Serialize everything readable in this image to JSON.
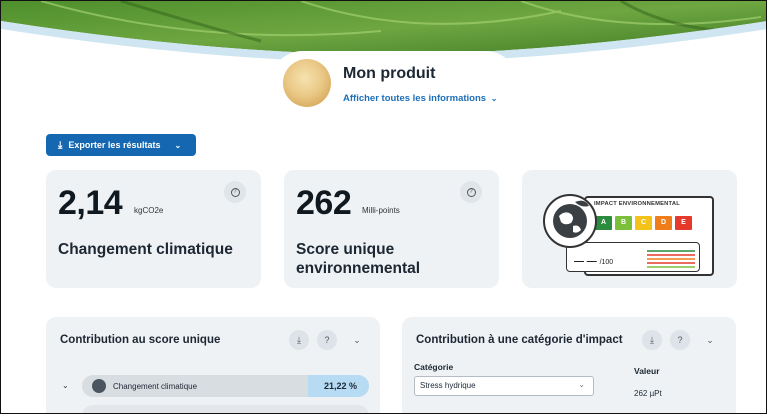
{
  "product": {
    "title": "Mon produit",
    "link_label": "Afficher toutes les informations",
    "link_chevron": "⌄"
  },
  "toolbar": {
    "export_label": "Exporter les résultats",
    "export_icon": "⤓",
    "export_chevron": "⌄"
  },
  "cards": {
    "climate": {
      "value": "2,14",
      "unit": "kgCO2e",
      "label": "Changement climatique"
    },
    "single_score": {
      "value": "262",
      "unit": "Milli-points",
      "label": "Score unique environnemental"
    },
    "eco_label": {
      "title": "IMPACT ENVIRONNEMENTAL",
      "grades": [
        "A",
        "B",
        "C",
        "D",
        "E"
      ],
      "grade_colors": [
        "#2a8c3c",
        "#7cbf3a",
        "#f5c21a",
        "#ef7d1a",
        "#e53a2b"
      ],
      "score_text": "— —",
      "score_suffix": "/100"
    }
  },
  "contribution_single": {
    "title": "Contribution au score unique",
    "row_label": "Changement climatique",
    "row_percent": "21,22 %",
    "row_percent_value": 21.22
  },
  "contribution_category": {
    "title": "Contribution à une catégorie d'impact",
    "category_label": "Catégorie",
    "category_value": "Stress hydrique",
    "value_label": "Valeur",
    "value_text": "262 µPt"
  },
  "icons": {
    "download": "download-icon",
    "help": "help-icon",
    "chevron": "chevron-down-icon"
  },
  "colors": {
    "primary": "#1467b0",
    "card_bg": "#eef2f5",
    "percent_fill": "#b7dbf3",
    "hero_green": "#5f9a3a",
    "hero_accent": "#cfe6f2"
  }
}
